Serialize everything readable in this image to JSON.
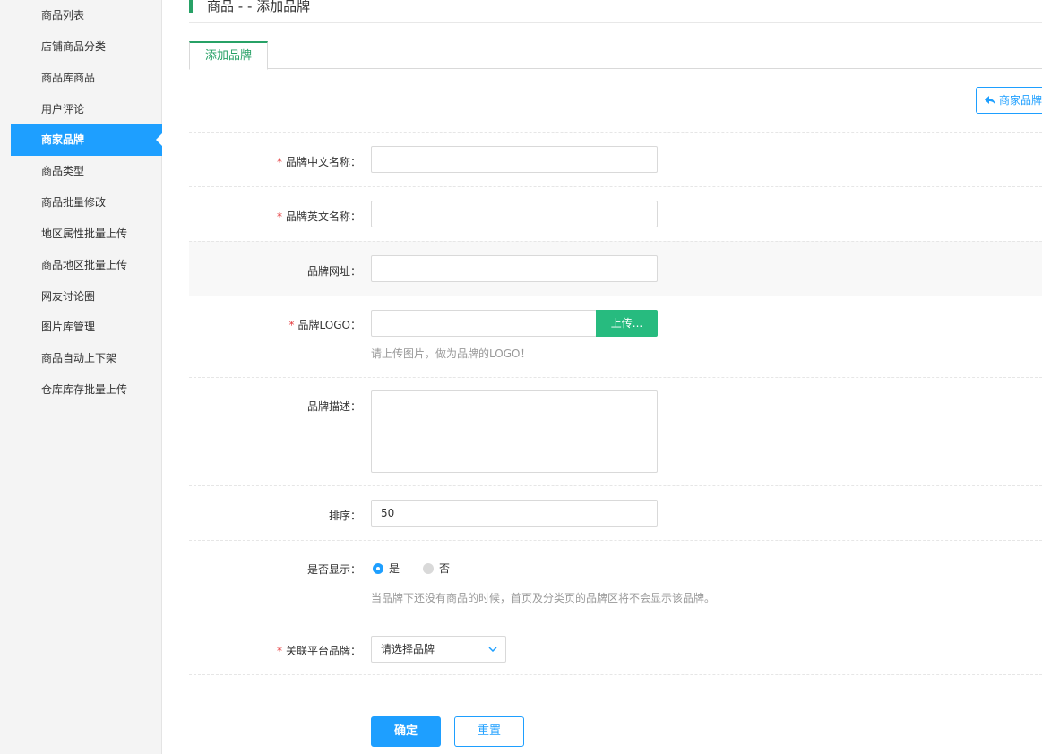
{
  "sidebar": {
    "items": [
      {
        "label": "商品列表",
        "active": false
      },
      {
        "label": "店铺商品分类",
        "active": false
      },
      {
        "label": "商品库商品",
        "active": false
      },
      {
        "label": "用户评论",
        "active": false
      },
      {
        "label": "商家品牌",
        "active": true
      },
      {
        "label": "商品类型",
        "active": false
      },
      {
        "label": "商品批量修改",
        "active": false
      },
      {
        "label": "地区属性批量上传",
        "active": false
      },
      {
        "label": "商品地区批量上传",
        "active": false
      },
      {
        "label": "网友讨论圈",
        "active": false
      },
      {
        "label": "图片库管理",
        "active": false
      },
      {
        "label": "商品自动上下架",
        "active": false
      },
      {
        "label": "仓库库存批量上传",
        "active": false
      }
    ]
  },
  "header": {
    "title": "商品 - - 添加品牌"
  },
  "tabs": [
    {
      "label": "添加品牌",
      "active": true
    }
  ],
  "toolbar": {
    "back_label": "商家品牌"
  },
  "form": {
    "required_mark": "*",
    "name_cn": {
      "label": "品牌中文名称：",
      "value": ""
    },
    "name_en": {
      "label": "品牌英文名称：",
      "value": ""
    },
    "website": {
      "label": "品牌网址：",
      "value": ""
    },
    "logo": {
      "label": "品牌LOGO：",
      "upload_label": "上传...",
      "hint": "请上传图片，做为品牌的LOGO！"
    },
    "description": {
      "label": "品牌描述："
    },
    "sort": {
      "label": "排序：",
      "value": "50"
    },
    "show": {
      "label": "是否显示：",
      "options": [
        "是",
        "否"
      ],
      "selected": "是",
      "hint": "当品牌下还没有商品的时候，首页及分类页的品牌区将不会显示该品牌。"
    },
    "platform_brand": {
      "label": "关联平台品牌：",
      "selected": "请选择品牌"
    }
  },
  "actions": {
    "confirm_label": "确定",
    "reset_label": "重置"
  },
  "colors": {
    "accent_blue": "#1e9fff",
    "accent_green": "#27a166",
    "upload_green": "#27bb7f",
    "required_red": "#e4393c"
  }
}
